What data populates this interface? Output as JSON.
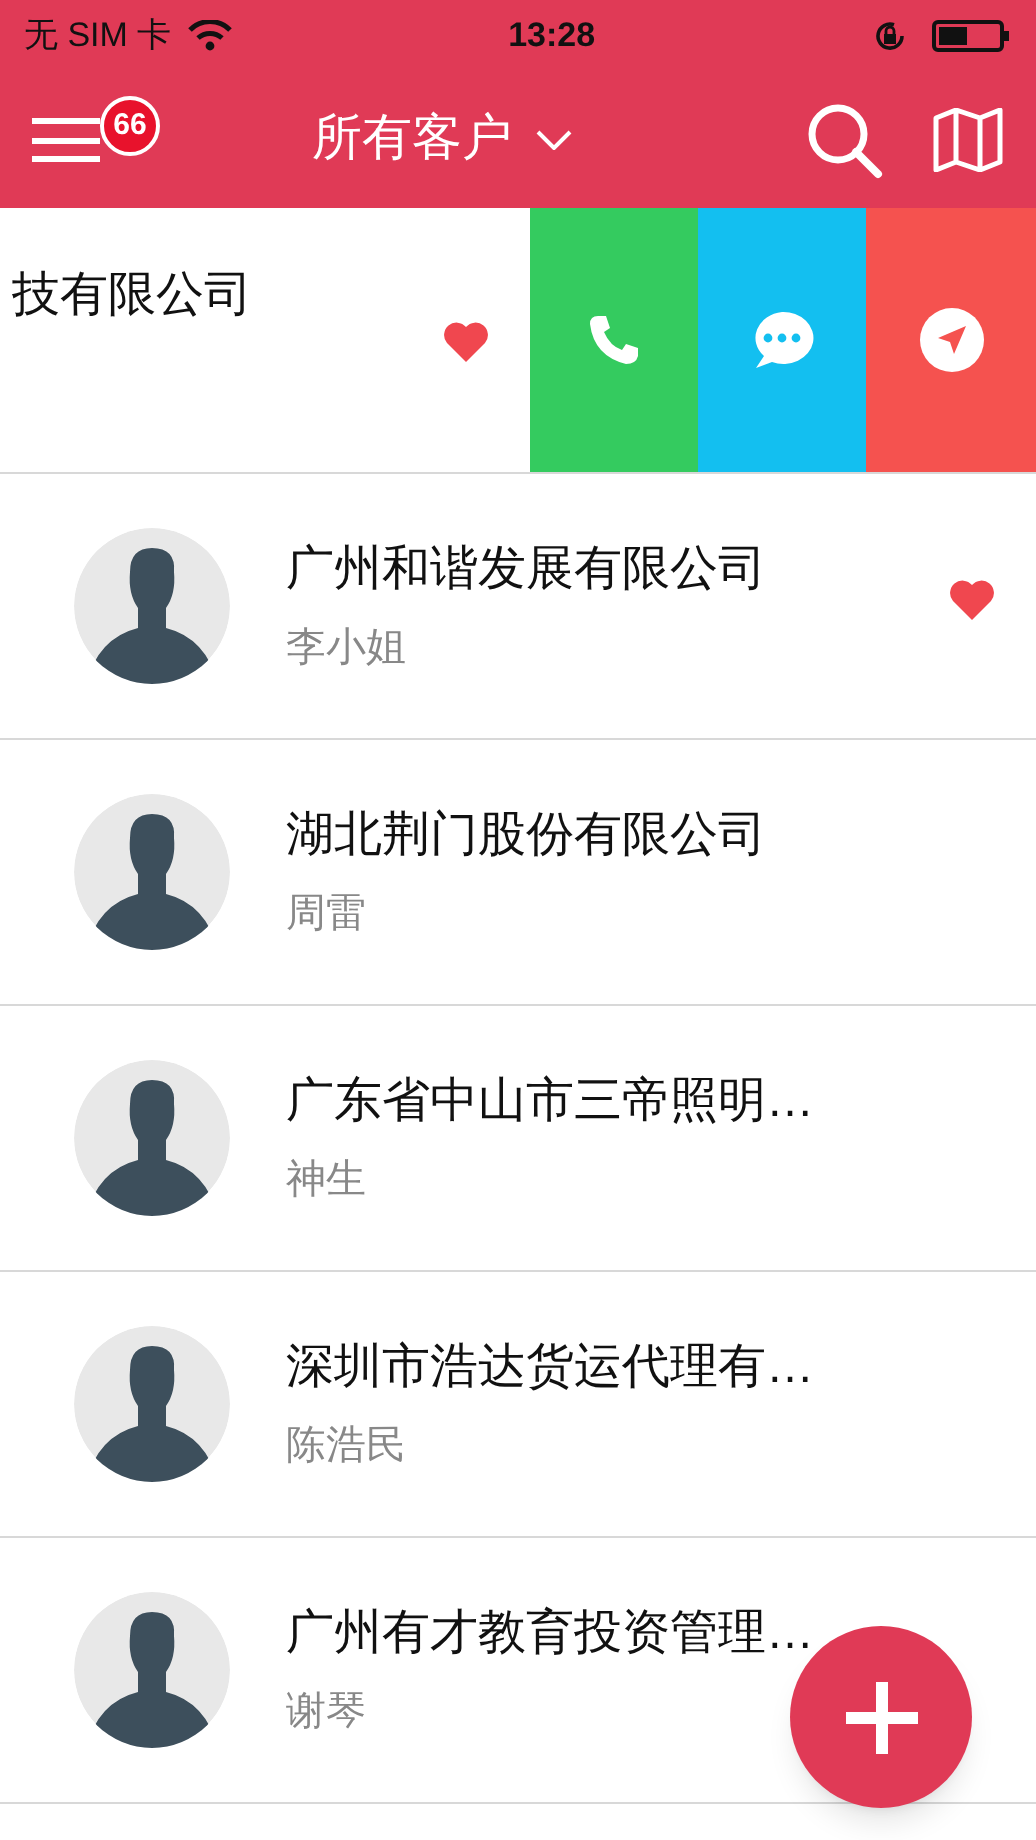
{
  "status_bar": {
    "carrier": "无 SIM 卡",
    "time": "13:28"
  },
  "nav": {
    "badge": "66",
    "title": "所有客户"
  },
  "swiped_row": {
    "name": "技有限公司",
    "favorite": true
  },
  "customers": [
    {
      "name": "广州和谐发展有限公司",
      "contact": "李小姐",
      "favorite": true
    },
    {
      "name": "湖北荆门股份有限公司",
      "contact": "周雷",
      "favorite": false
    },
    {
      "name": "广东省中山市三帝照明…",
      "contact": "神生",
      "favorite": false
    },
    {
      "name": "深圳市浩达货运代理有…",
      "contact": "陈浩民",
      "favorite": false
    },
    {
      "name": "广州有才教育投资管理…",
      "contact": "谢琴",
      "favorite": false
    }
  ]
}
